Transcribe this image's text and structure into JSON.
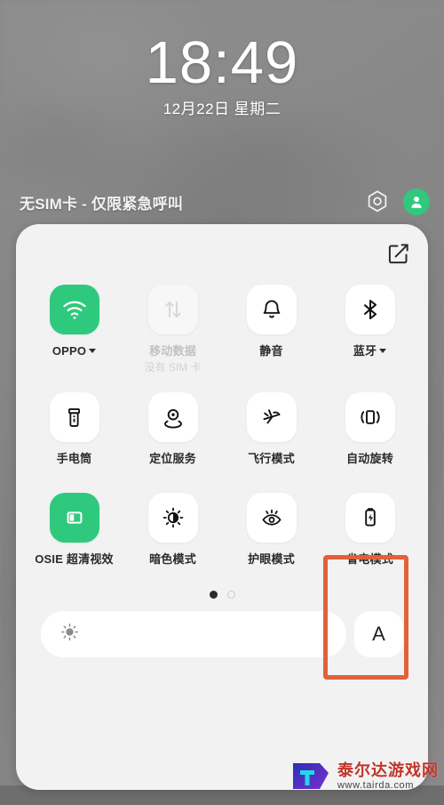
{
  "lockscreen": {
    "time": "18:49",
    "date": "12月22日  星期二",
    "sim_status": "无SIM卡 - 仅限紧急呼叫",
    "camera_icon": "camera-hexagon-icon",
    "avatar_icon": "user-avatar-icon"
  },
  "panel": {
    "edit_icon": "edit-pencil-square-icon",
    "rows": [
      [
        {
          "icon": "wifi-icon",
          "label": "OPPO",
          "sub": "",
          "state": "on",
          "caret": true
        },
        {
          "icon": "mobile-data-icon",
          "label": "移动数据",
          "sub": "没有 SIM 卡",
          "state": "dim",
          "caret": false
        },
        {
          "icon": "bell-mute-icon",
          "label": "静音",
          "sub": "",
          "state": "off",
          "caret": false
        },
        {
          "icon": "bluetooth-icon",
          "label": "蓝牙",
          "sub": "",
          "state": "off",
          "caret": true
        }
      ],
      [
        {
          "icon": "flashlight-icon",
          "label": "手电筒",
          "sub": "",
          "state": "off",
          "caret": false
        },
        {
          "icon": "location-pin-icon",
          "label": "定位服务",
          "sub": "",
          "state": "off",
          "caret": false
        },
        {
          "icon": "airplane-icon",
          "label": "飞行模式",
          "sub": "",
          "state": "off",
          "caret": false
        },
        {
          "icon": "auto-rotate-icon",
          "label": "自动旋转",
          "sub": "",
          "state": "off",
          "caret": false
        }
      ],
      [
        {
          "icon": "osie-screen-icon",
          "label": "OSIE 超清视效",
          "sub": "",
          "state": "on",
          "caret": false
        },
        {
          "icon": "dark-mode-icon",
          "label": "暗色模式",
          "sub": "",
          "state": "off",
          "caret": false
        },
        {
          "icon": "eye-care-icon",
          "label": "护眼模式",
          "sub": "",
          "state": "off",
          "caret": false
        },
        {
          "icon": "battery-saver-icon",
          "label": "省电模式",
          "sub": "",
          "state": "off",
          "caret": false
        }
      ]
    ],
    "pages": {
      "count": 2,
      "active": 0
    },
    "brightness": {
      "icon": "brightness-sun-icon",
      "value": 0,
      "auto_label": "A"
    },
    "highlight_color": "#e4603a",
    "accent_color": "#2fc97e"
  },
  "watermark": {
    "title": "泰尔达游戏网",
    "url": "www.tairda.com"
  }
}
